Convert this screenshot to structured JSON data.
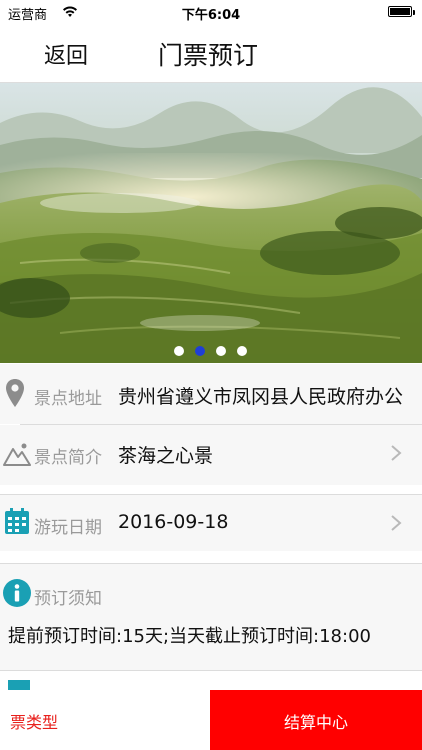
{
  "status_bar": {
    "carrier": "运营商",
    "time": "下午6:04"
  },
  "nav": {
    "back_label": "返回",
    "title": "门票预订"
  },
  "banner": {
    "image": "karst-tea-hills-landscape",
    "dots": 4,
    "active_dot": 1
  },
  "rows": {
    "address": {
      "label": "景点地址",
      "value": "贵州省遵义市凤冈县人民政府办公",
      "icon": "location-pin-icon"
    },
    "intro": {
      "label": "景点简介",
      "value": "茶海之心景",
      "icon": "mountain-icon"
    },
    "date": {
      "label": "游玩日期",
      "value": "2016-09-18",
      "icon": "calendar-icon"
    },
    "notice": {
      "label": "预订须知",
      "icon": "info-icon",
      "text": "提前预订时间:15天;当天截止预订时间:18:00"
    }
  },
  "bottom_bar": {
    "ticket_type_label": "票类型",
    "checkout_label": "结算中心"
  },
  "colors": {
    "accent_red": "#ff0000",
    "icon_teal": "#1aa0b4",
    "label_grey": "#9a9a9a"
  }
}
